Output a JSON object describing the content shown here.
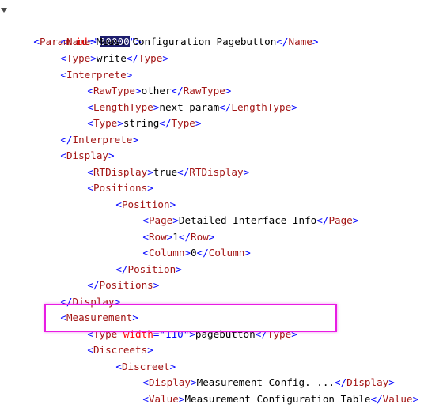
{
  "root": {
    "tag": "Param",
    "attr_name": "id",
    "attr_value": "30000"
  },
  "name": {
    "tag": "Name",
    "value": "Meas. Configuration Pagebutton"
  },
  "type": {
    "tag": "Type",
    "value": "write"
  },
  "interprete": {
    "tag": "Interprete",
    "raw_type": {
      "tag": "RawType",
      "value": "other"
    },
    "length_type": {
      "tag": "LengthType",
      "value": "next param"
    },
    "type": {
      "tag": "Type",
      "value": "string"
    }
  },
  "display": {
    "tag": "Display",
    "rt_display": {
      "tag": "RTDisplay",
      "value": "true"
    },
    "positions": {
      "tag": "Positions",
      "position": {
        "tag": "Position",
        "page": {
          "tag": "Page",
          "value": "Detailed Interface Info"
        },
        "row": {
          "tag": "Row",
          "value": "1"
        },
        "column": {
          "tag": "Column",
          "value": "0"
        }
      }
    }
  },
  "measurement": {
    "tag": "Measurement",
    "type": {
      "tag": "Type",
      "attr_name": "width",
      "attr_value": "110",
      "value": "pagebutton"
    },
    "discreets": {
      "tag": "Discreets",
      "discreet": {
        "tag": "Discreet",
        "display": {
          "tag": "Display",
          "value": "Measurement Config. ..."
        },
        "value": {
          "tag": "Value",
          "value": "Measurement Configuration Table"
        }
      }
    }
  },
  "colors": {
    "highlight_border": "#e81ce3",
    "selection_bg": "#1e1e6e",
    "tag": "#a31515",
    "bracket": "#0000ff",
    "attribute": "#ff0000"
  },
  "icons": {
    "collapse_toggle": "triangle-down-icon"
  }
}
